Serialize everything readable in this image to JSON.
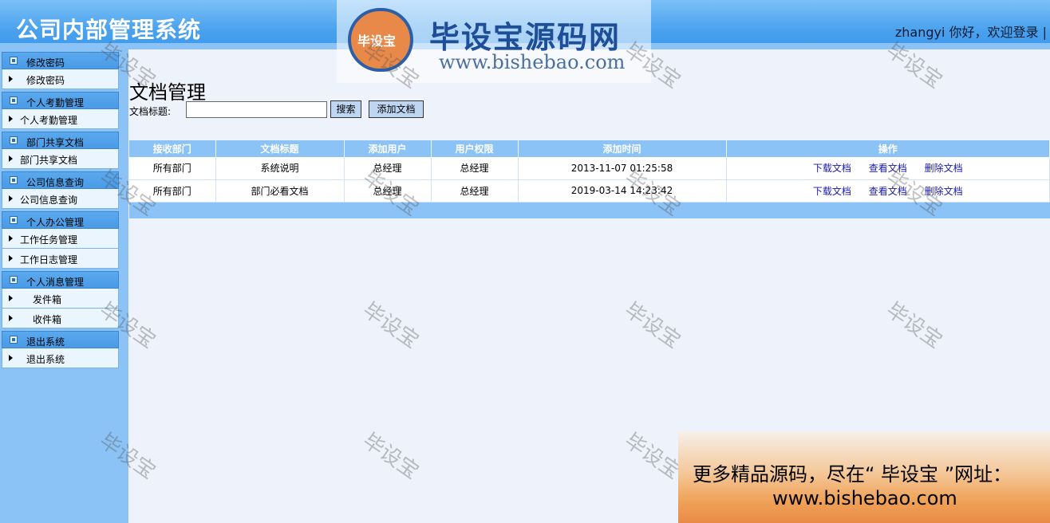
{
  "header": {
    "title": "公司内部管理系统",
    "welcome": "zhangyi 你好，欢迎登录 |"
  },
  "watermark_logo": {
    "badge": "毕设宝",
    "brand": "毕设宝源码网",
    "url": "www.bishebao.com"
  },
  "watermark_text": "毕设宝",
  "sidebar": {
    "groups": [
      {
        "title": "修改密码",
        "items": [
          "修改密码"
        ]
      },
      {
        "title": "个人考勤管理",
        "items": [
          "个人考勤管理"
        ]
      },
      {
        "title": "部门共享文档",
        "items": [
          "部门共享文档"
        ]
      },
      {
        "title": "公司信息查询",
        "items": [
          "公司信息查询"
        ]
      },
      {
        "title": "个人办公管理",
        "items": [
          "工作任务管理",
          "工作日志管理"
        ]
      },
      {
        "title": "个人消息管理",
        "items": [
          "发件箱",
          "收件箱"
        ]
      },
      {
        "title": "退出系统",
        "items": [
          "退出系统"
        ]
      }
    ]
  },
  "main": {
    "page_title": "文档管理",
    "search_label": "文档标题:",
    "search_value": "",
    "search_button": "搜索",
    "add_button": "添加文档",
    "columns": [
      "接收部门",
      "文档标题",
      "添加用户",
      "用户权限",
      "添加时间",
      "操作"
    ],
    "rows": [
      {
        "dept": "所有部门",
        "title": "系统说明",
        "user": "总经理",
        "role": "总经理",
        "time": "2013-11-07 01:25:58"
      },
      {
        "dept": "所有部门",
        "title": "部门必看文档",
        "user": "总经理",
        "role": "总经理",
        "time": "2019-03-14 14:23:42"
      }
    ],
    "actions": [
      "下载文档",
      "查看文档",
      "删除文档"
    ]
  },
  "ad": {
    "line1": "更多精品源码，尽在“ 毕设宝 ”网址：",
    "line2": "www.bishebao.com"
  },
  "colors": {
    "header_top": "#7cc0f6",
    "header_bottom": "#3e98ea",
    "sidebar_bg": "#8cc3f6",
    "main_bg": "#eef2fb",
    "link": "#1a1aa8"
  }
}
